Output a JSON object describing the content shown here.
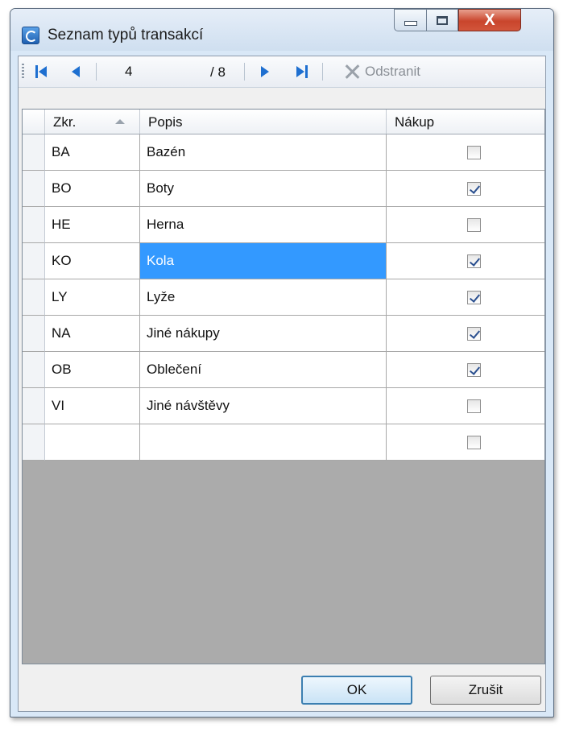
{
  "window": {
    "title": "Seznam typů transakcí",
    "close_glyph": "X"
  },
  "navigator": {
    "position": "4",
    "of_label": "/ 8",
    "delete_label": "Odstranit"
  },
  "grid": {
    "columns": [
      {
        "label": "Zkr.",
        "sorted": "ascending"
      },
      {
        "label": "Popis"
      },
      {
        "label": "Nákup"
      }
    ],
    "rows": [
      {
        "code": "BA",
        "desc": "Bazén",
        "purchase": false
      },
      {
        "code": "BO",
        "desc": "Boty",
        "purchase": true
      },
      {
        "code": "HE",
        "desc": "Herna",
        "purchase": false
      },
      {
        "code": "KO",
        "desc": "Kola",
        "purchase": true,
        "selected": true
      },
      {
        "code": "LY",
        "desc": "Lyže",
        "purchase": true
      },
      {
        "code": "NA",
        "desc": "Jiné nákupy",
        "purchase": true
      },
      {
        "code": "OB",
        "desc": "Oblečení",
        "purchase": true
      },
      {
        "code": "VI",
        "desc": "Jiné návštěvy",
        "purchase": false
      },
      {
        "code": "",
        "desc": "",
        "purchase": false
      }
    ]
  },
  "buttons": {
    "ok": "OK",
    "cancel": "Zrušit"
  },
  "colors": {
    "selection": "#3399ff",
    "grid_empty": "#ababab",
    "nav_arrow": "#1e6fd0"
  }
}
